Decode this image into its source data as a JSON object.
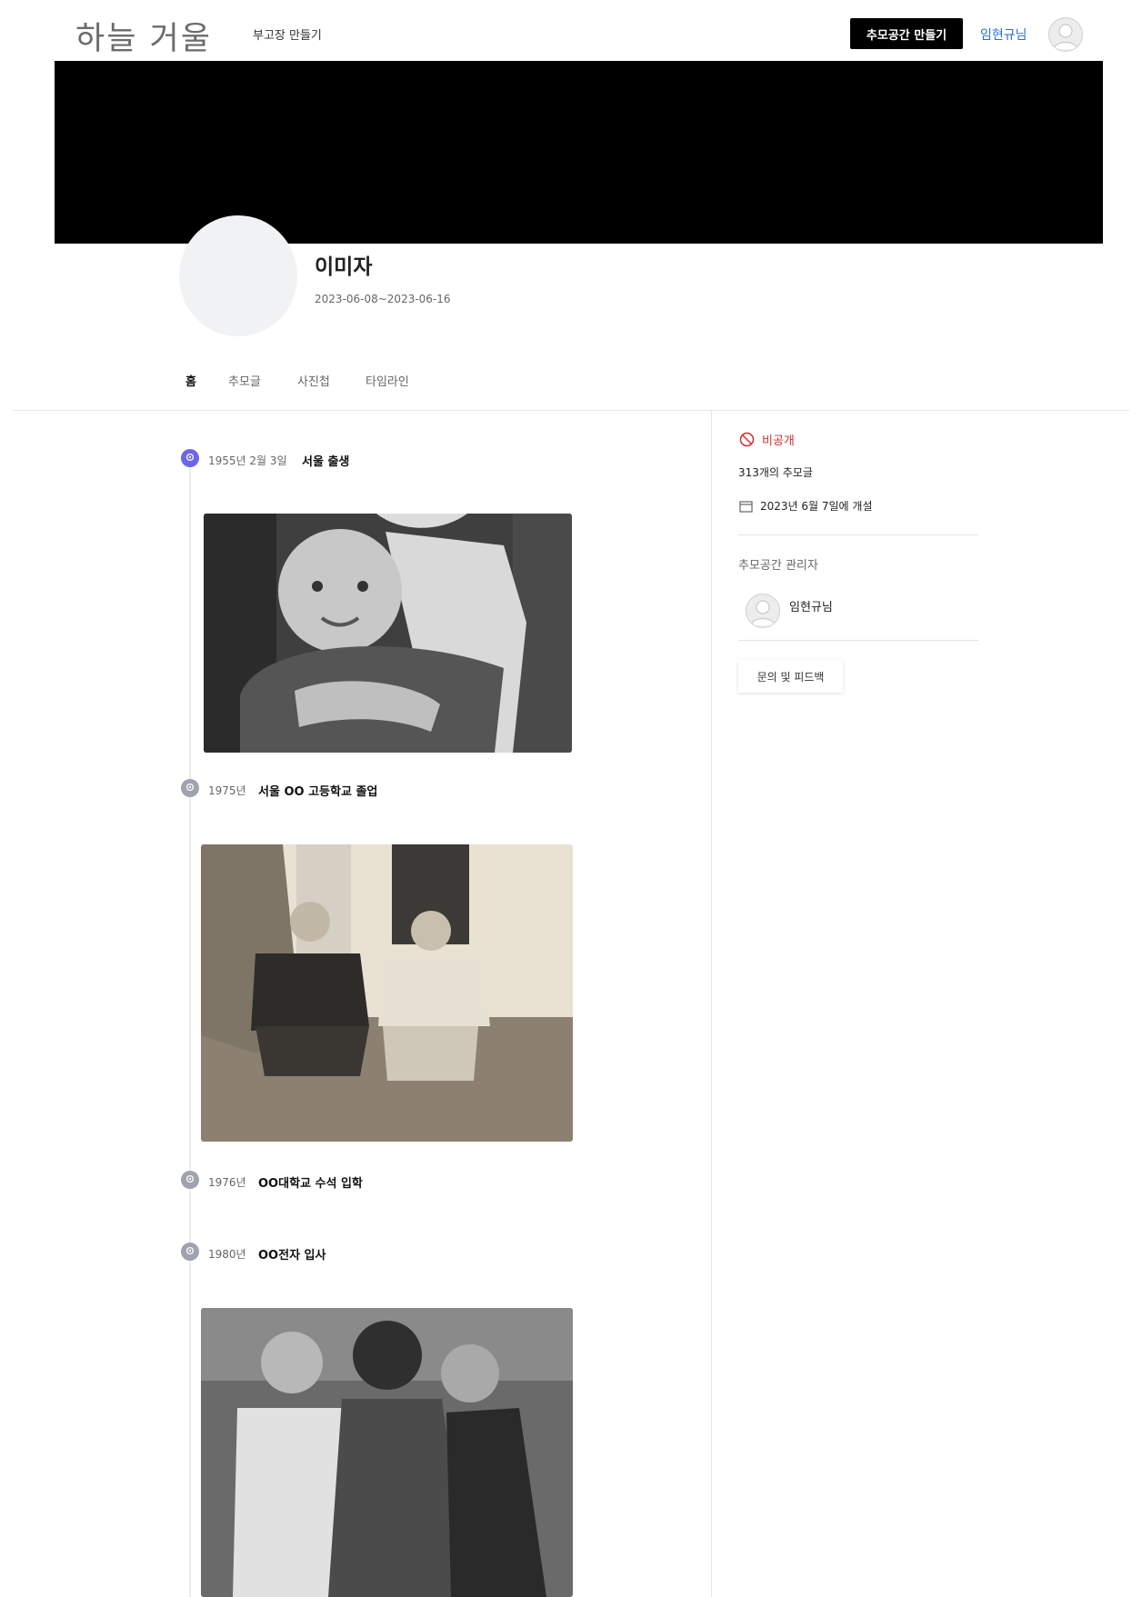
{
  "header": {
    "logo": "하늘 거울",
    "nav_link": "부고장 만들기",
    "cta": "추모공간 만들기",
    "user": "임현규님"
  },
  "profile": {
    "name": "이미자",
    "dates": "2023-06-08~2023-06-16"
  },
  "tabs": [
    "홈",
    "추모글",
    "사진첩",
    "타임라인"
  ],
  "timeline": [
    {
      "date": "1955년 2월 3일",
      "title": "서울 출생",
      "has_photo": true
    },
    {
      "date": "1975년",
      "title": "서울 OO 고등학교 졸업",
      "has_photo": true
    },
    {
      "date": "1976년",
      "title": "OO대학교 수석 입학",
      "has_photo": false
    },
    {
      "date": "1980년",
      "title": "OO전자 입사",
      "has_photo": true
    }
  ],
  "sidebar": {
    "visibility": "비공개",
    "post_count": "313개의 추모글",
    "opened": "2023년 6월 7일에 개설",
    "admin_label": "추모공간 관리자",
    "admin_name": "임현규님",
    "feedback": "문의 및 피드백"
  },
  "colors": {
    "accent": "#6b67e8",
    "link": "#2a6fd6",
    "private": "#d32f2f",
    "banner": "#000000"
  }
}
